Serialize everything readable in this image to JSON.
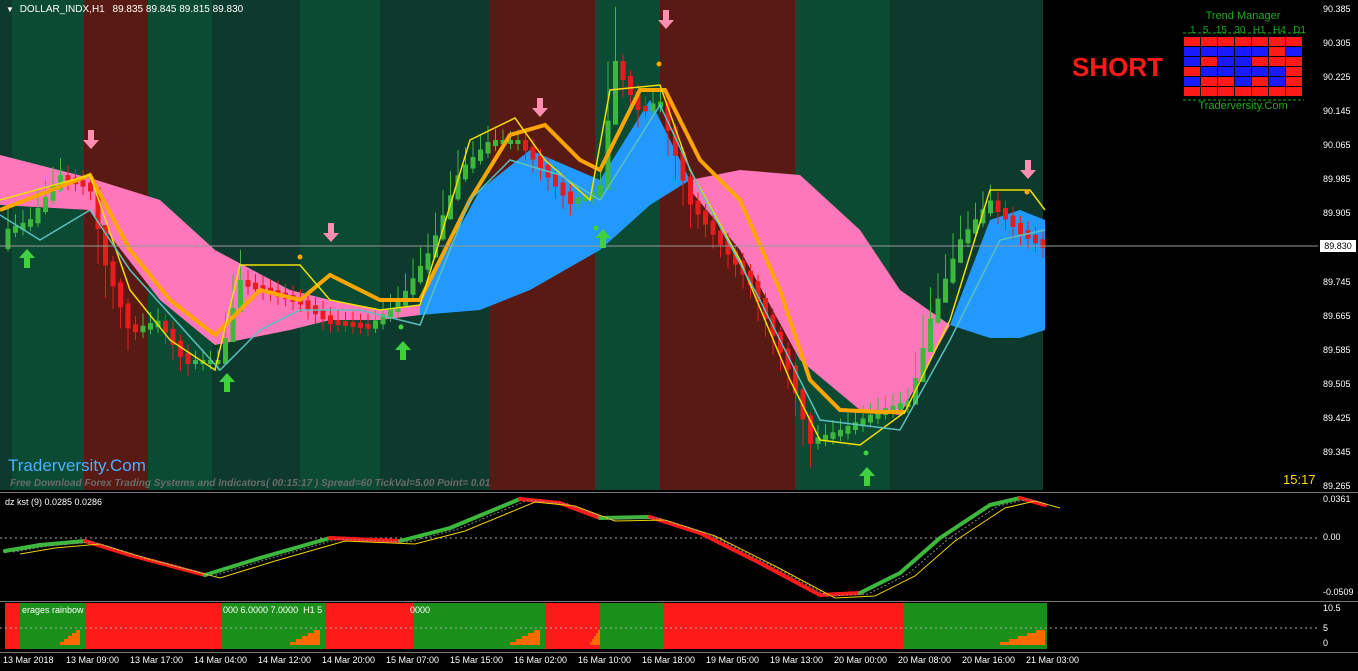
{
  "chart_header": {
    "symbol": "DOLLAR_INDX,H1",
    "ohlc": "89.835 89.845 89.815 89.830"
  },
  "signal": {
    "label": "SHORT",
    "color": "#ff1a1a"
  },
  "trend_manager": {
    "title": "Trend Manager",
    "timeframes": [
      "1",
      "5",
      "15",
      "30",
      "H1",
      "H4",
      "D1"
    ],
    "site": "Traderversity.Com",
    "grid": [
      [
        "red",
        "red",
        "red",
        "red",
        "red",
        "red",
        "red"
      ],
      [
        "blue",
        "blue",
        "blue",
        "blue",
        "blue",
        "red",
        "blue"
      ],
      [
        "blue",
        "red",
        "blue",
        "blue",
        "red",
        "red",
        "red"
      ],
      [
        "red",
        "blue",
        "blue",
        "blue",
        "blue",
        "blue",
        "red"
      ],
      [
        "blue",
        "red",
        "red",
        "blue",
        "red",
        "blue",
        "red"
      ],
      [
        "red",
        "red",
        "red",
        "red",
        "red",
        "red",
        "red"
      ]
    ]
  },
  "watermark": "Traderversity.Com",
  "info_line": "Free Download Forex Trading Systems and Indicators( 00:15:17 )  Spread=60  TickVal=5.00  Point= 0.01",
  "clock": "15:17",
  "current_price": "89.830",
  "price_axis": [
    "90.385",
    "90.305",
    "90.225",
    "90.145",
    "90.065",
    "89.985",
    "89.905",
    "89.745",
    "89.665",
    "89.585",
    "89.505",
    "89.425",
    "89.345",
    "89.265"
  ],
  "kst": {
    "title": "dz kst (9) 0.0285 0.0286",
    "axis": [
      "0.0361",
      "0.00",
      "-0.0509"
    ]
  },
  "rainbow": {
    "title": "erages rainbow",
    "values": "000 6.0000 7.0000  H1 5",
    "values2": "0000",
    "axis": [
      "10.5",
      "5",
      "0"
    ]
  },
  "time_axis": [
    "13 Mar 2018",
    "13 Mar 09:00",
    "13 Mar 17:00",
    "14 Mar 04:00",
    "14 Mar 12:00",
    "14 Mar 20:00",
    "15 Mar 07:00",
    "15 Mar 15:00",
    "16 Mar 02:00",
    "16 Mar 10:00",
    "16 Mar 18:00",
    "19 Mar 05:00",
    "19 Mar 13:00",
    "20 Mar 00:00",
    "20 Mar 08:00",
    "20 Mar 16:00",
    "21 Mar 03:00"
  ],
  "colors": {
    "bg_green": "#0b4a33",
    "bg_teal": "#0d3a2c",
    "bg_red": "#5a1a14",
    "cloud_pink": "#ff77bb",
    "cloud_blue": "#2299ff",
    "candle_up": "#3cb83c",
    "candle_down": "#e81c1c",
    "ma_orange": "#ffa500",
    "line_yellow": "#f0e000",
    "line_teal": "#5bc0c0"
  }
}
